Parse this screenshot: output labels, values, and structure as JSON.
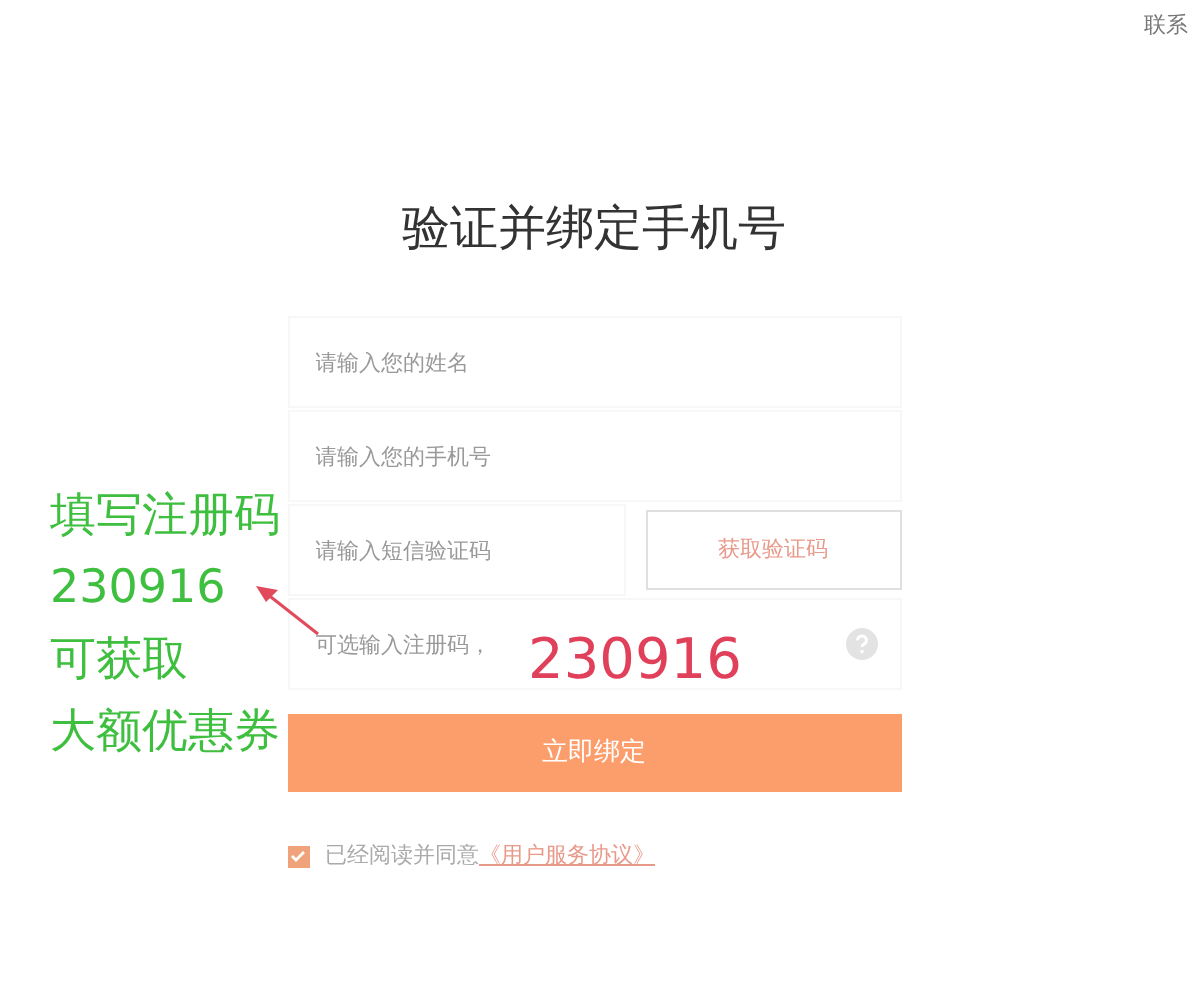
{
  "top_link": "联系",
  "title": "验证并绑定手机号",
  "fields": [
    {
      "kind": "text",
      "placeholder": "请输入您的姓名"
    },
    {
      "kind": "text",
      "placeholder": "请输入您的手机号"
    },
    {
      "kind": "code",
      "placeholder": "请输入短信验证码",
      "button": "获取验证码"
    },
    {
      "kind": "help",
      "placeholder": "可选输入注册码，"
    }
  ],
  "submit": "立即绑定",
  "agreement": {
    "checked": true,
    "text": "已经阅读并同意",
    "link": "《用户服务协议》"
  },
  "annotation": {
    "lines": [
      "填写注册码",
      "230916",
      "可获取",
      "大额优惠券"
    ],
    "overlay_code": "230916"
  }
}
